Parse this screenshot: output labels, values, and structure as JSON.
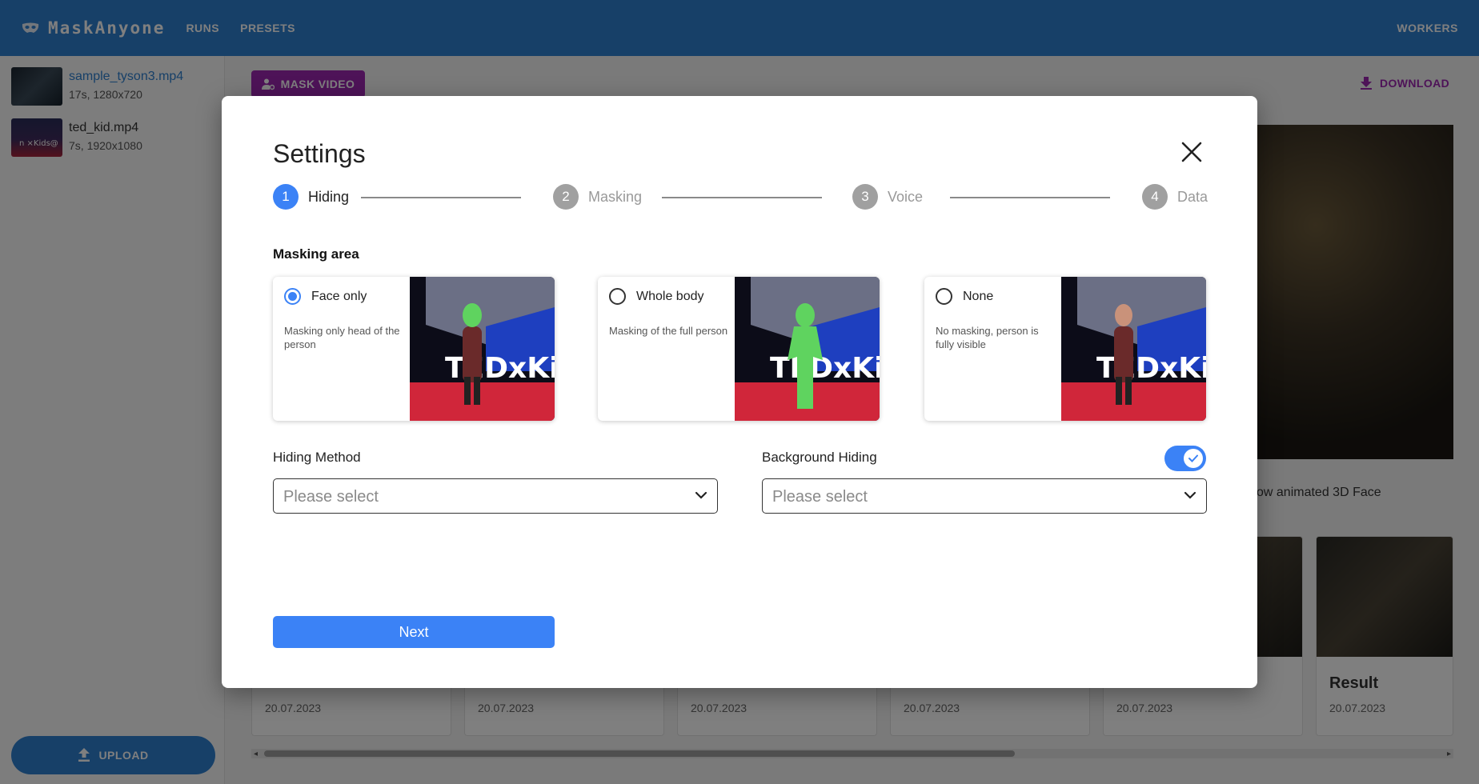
{
  "app": {
    "title": "MaskAnyone",
    "nav": [
      "RUNS",
      "PRESETS"
    ],
    "nav_right": "WORKERS"
  },
  "sidebar": {
    "videos": [
      {
        "name": "sample_tyson3.mp4",
        "meta": "17s, 1280x720"
      },
      {
        "name": "ted_kid.mp4",
        "meta": "7s, 1920x1080",
        "thumb_text": "n  ×Kids@"
      }
    ],
    "upload_label": "UPLOAD"
  },
  "main": {
    "mask_video_label": "MASK VIDEO",
    "download_label": "DOWNLOAD",
    "preview_caption": "ow animated 3D Face",
    "runs": [
      {
        "title": "",
        "date": "20.07.2023"
      },
      {
        "title": "",
        "date": "20.07.2023"
      },
      {
        "title": "",
        "date": "20.07.2023"
      },
      {
        "title": "",
        "date": "20.07.2023"
      },
      {
        "title": "",
        "date": "20.07.2023"
      },
      {
        "title": "Result",
        "date": "20.07.2023"
      }
    ]
  },
  "modal": {
    "title": "Settings",
    "steps": [
      {
        "number": "1",
        "label": "Hiding",
        "active": true
      },
      {
        "number": "2",
        "label": "Masking",
        "active": false
      },
      {
        "number": "3",
        "label": "Voice",
        "active": false
      },
      {
        "number": "4",
        "label": "Data",
        "active": false
      }
    ],
    "section_label": "Masking area",
    "options": [
      {
        "label": "Face only",
        "desc": "Masking only head of the person",
        "selected": true
      },
      {
        "label": "Whole body",
        "desc": "Masking of the full person",
        "selected": false
      },
      {
        "label": "None",
        "desc": "No masking, person is fully visible",
        "selected": false
      }
    ],
    "hiding_method": {
      "label": "Hiding Method",
      "value": "Please select"
    },
    "background_hiding": {
      "label": "Background Hiding",
      "value": "Please select",
      "enabled": true
    },
    "next_label": "Next",
    "image_stage_text": "TEDxKids"
  },
  "colors": {
    "appbar": "#2f80d1",
    "accent": "#3b82f6",
    "purple": "#9c27b0",
    "mask_green": "#5fd35f"
  }
}
